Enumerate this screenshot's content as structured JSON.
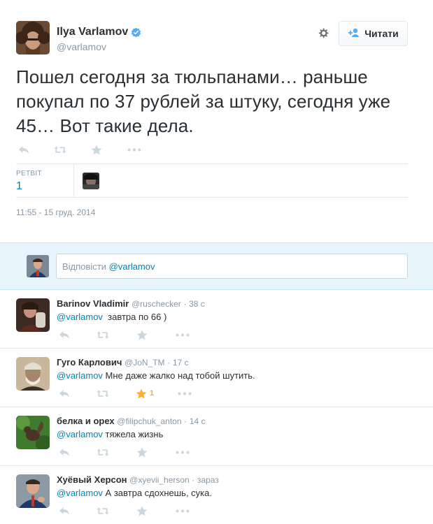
{
  "tweet": {
    "author_name": "Ilya Varlamov",
    "author_handle": "@varlamov",
    "follow_label": "Читати",
    "text": "Пошел сегодня за тюльпанами… раньше покупал по 37 рублей за штуку, сегодня уже 45… Вот такие дела.",
    "retweet_label": "РЕТВІТ",
    "retweet_count": "1",
    "timestamp": "11:55 - 15 груд. 2014"
  },
  "reply_box": {
    "placeholder_prefix": "Відповісти",
    "mention": "@varlamov"
  },
  "replies": [
    {
      "name": "Barinov Vladimir",
      "handle": "@ruschecker",
      "time": "38 с",
      "mention": "@varlamov",
      "text": "  завтра по 66 )",
      "fav_count": ""
    },
    {
      "name": "Гуго Карлович",
      "handle": "@JoN_TM",
      "time": "17 с",
      "mention": "@varlamov",
      "text": " Мне даже жалко над тобой шутить.",
      "fav_count": "1"
    },
    {
      "name": "белка и орех",
      "handle": "@filipchuk_anton",
      "time": "14 с",
      "mention": "@varlamov",
      "text": " тяжела жизнь",
      "fav_count": ""
    },
    {
      "name": "Хуёвый Херсон",
      "handle": "@xyevii_herson",
      "time": "зараз",
      "mention": "@varlamov",
      "text": " А завтра сдохнешь, сука.",
      "fav_count": ""
    }
  ],
  "colors": {
    "accent": "#0084b4",
    "verified": "#55acee",
    "favorite": "#ffac33",
    "muted": "#8899a6"
  },
  "icons": [
    "verified-badge-icon",
    "gear-icon",
    "follow-person-icon",
    "reply-icon",
    "retweet-icon",
    "favorite-icon",
    "more-icon"
  ]
}
